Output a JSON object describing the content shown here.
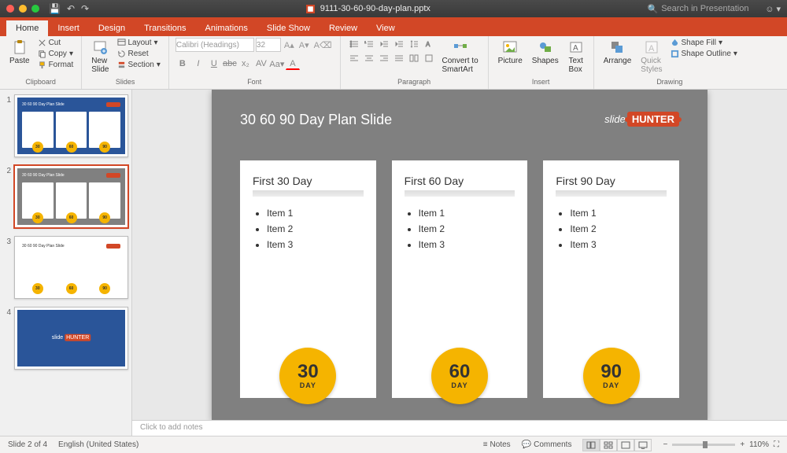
{
  "titlebar": {
    "filename": "9111-30-60-90-day-plan.pptx",
    "search_placeholder": "Search in Presentation"
  },
  "tabs": [
    "Home",
    "Insert",
    "Design",
    "Transitions",
    "Animations",
    "Slide Show",
    "Review",
    "View"
  ],
  "active_tab": 0,
  "ribbon": {
    "clipboard": {
      "label": "Clipboard",
      "paste": "Paste",
      "cut": "Cut",
      "copy": "Copy",
      "format": "Format"
    },
    "slides": {
      "label": "Slides",
      "new_slide": "New\nSlide",
      "layout": "Layout",
      "reset": "Reset",
      "section": "Section"
    },
    "font": {
      "label": "Font",
      "name": "Calibri (Headings)",
      "size": "32"
    },
    "paragraph": {
      "label": "Paragraph",
      "convert": "Convert to\nSmartArt"
    },
    "insert": {
      "label": "Insert",
      "picture": "Picture",
      "shapes": "Shapes",
      "textbox": "Text\nBox"
    },
    "drawing": {
      "label": "Drawing",
      "arrange": "Arrange",
      "quick": "Quick\nStyles",
      "fill": "Shape Fill",
      "outline": "Shape Outline"
    }
  },
  "thumbs": [
    {
      "num": "1",
      "bg": "blue",
      "title": "30 60 90 Day Plan Slide",
      "cards": [
        "30",
        "60",
        "90"
      ]
    },
    {
      "num": "2",
      "bg": "grey",
      "title": "30 60 90 Day Plan Slide",
      "cards": [
        "30",
        "60",
        "90"
      ],
      "selected": true
    },
    {
      "num": "3",
      "bg": "white",
      "title": "30 60 90 Day Plan Slide",
      "cards": [
        "30",
        "60",
        "90"
      ]
    },
    {
      "num": "4",
      "bg": "blue",
      "logo_only": true
    }
  ],
  "slide": {
    "title": "30 60 90 Day Plan Slide",
    "logo_prefix": "slide",
    "logo_badge": "HUNTER",
    "cards": [
      {
        "head": "First 30 Day",
        "items": [
          "Item 1",
          "Item 2",
          "Item 3"
        ],
        "num": "30",
        "day": "DAY"
      },
      {
        "head": "First 60 Day",
        "items": [
          "Item 1",
          "Item 2",
          "Item 3"
        ],
        "num": "60",
        "day": "DAY"
      },
      {
        "head": "First 90 Day",
        "items": [
          "Item 1",
          "Item 2",
          "Item 3"
        ],
        "num": "90",
        "day": "DAY"
      }
    ]
  },
  "notes_placeholder": "Click to add notes",
  "status": {
    "slide": "Slide 2 of 4",
    "lang": "English (United States)",
    "notes": "Notes",
    "comments": "Comments",
    "zoom": "110%"
  }
}
